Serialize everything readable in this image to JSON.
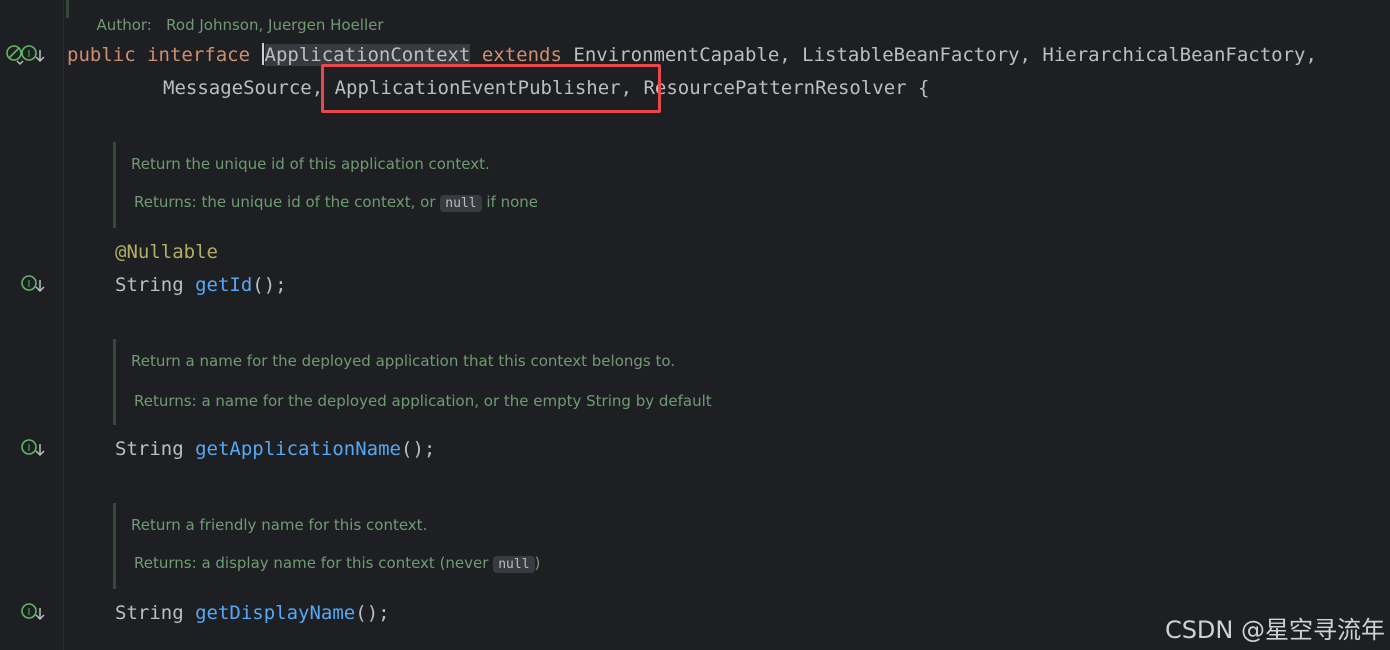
{
  "header_doc": {
    "author_label": "Author:",
    "author_value": "Rod Johnson, Juergen Hoeller"
  },
  "declaration": {
    "kw_public": "public",
    "kw_interface": "interface",
    "interface_name": "ApplicationContext",
    "kw_extends": "extends",
    "line1_rest": "EnvironmentCapable, ListableBeanFactory, HierarchicalBeanFactory,",
    "line2_a": "MessageSource,",
    "line2_highlighted": "ApplicationEventPublisher,",
    "line2_b": "ResourcePatternResolver {"
  },
  "methods": [
    {
      "doc_summary": "Return the unique id of this application context.",
      "returns_label": "Returns:",
      "returns_before": "the unique id of the context, or",
      "returns_code": "null",
      "returns_after": "if none",
      "annotation": "@Nullable",
      "return_type": "String",
      "name": "getId",
      "suffix": "();"
    },
    {
      "doc_summary": "Return a name for the deployed application that this context belongs to.",
      "returns_label": "Returns:",
      "returns_text": "a name for the deployed application, or the empty String by default",
      "return_type": "String",
      "name": "getApplicationName",
      "suffix": "();"
    },
    {
      "doc_summary": "Return a friendly name for this context.",
      "returns_label": "Returns:",
      "returns_before": "a display name for this context (never",
      "returns_code": "null",
      "returns_after": ")",
      "return_type": "String",
      "name": "getDisplayName",
      "suffix": "();"
    }
  ],
  "gutter_icons": [
    "no-usages-icon",
    "implemented-interface-icon"
  ],
  "colors": {
    "keyword": "#cf8e6d",
    "method": "#56a8f5",
    "annotation": "#b3ae60",
    "doc": "#6f9b73",
    "highlight_box": "#e6484b"
  },
  "watermark": "CSDN @星空寻流年"
}
